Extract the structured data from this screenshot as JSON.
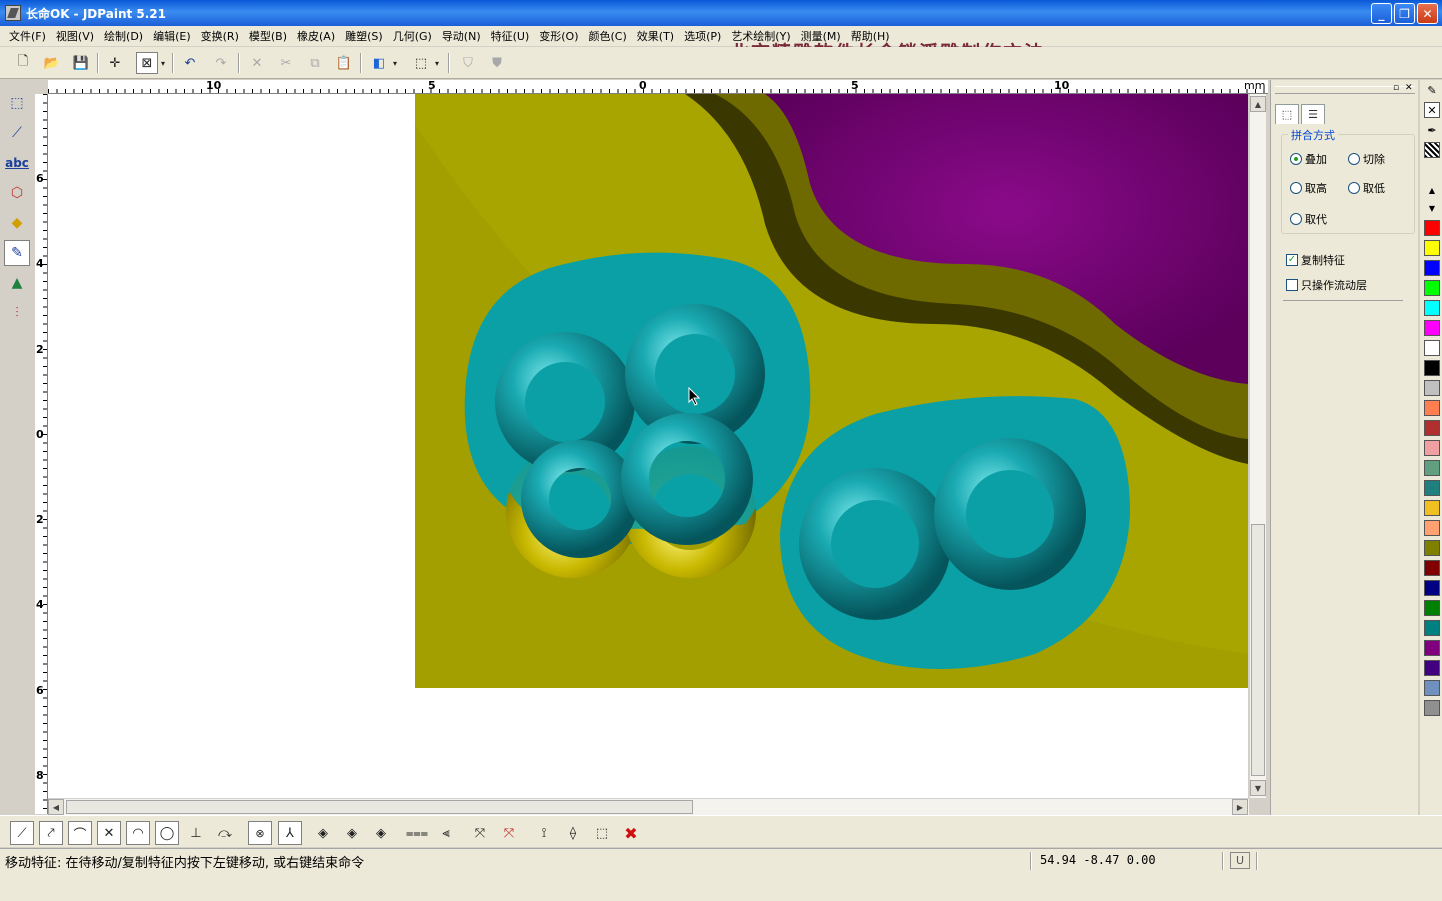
{
  "window": {
    "title": "长命OK - JDPaint 5.21"
  },
  "menu": [
    "文件(F)",
    "视图(V)",
    "绘制(D)",
    "编辑(E)",
    "变换(R)",
    "模型(B)",
    "橡皮(A)",
    "雕塑(S)",
    "几何(G)",
    "导动(N)",
    "特征(U)",
    "变形(O)",
    "颜色(C)",
    "效果(T)",
    "选项(P)",
    "艺术绘制(Y)",
    "测量(M)",
    "帮助(H)"
  ],
  "overlay_title": "北京精雕软件长命锁浮雕制作方法",
  "ruler": {
    "unit": "mm",
    "h_labels": [
      "10",
      "5",
      "0",
      "5",
      "10"
    ],
    "v_labels": [
      "6",
      "4",
      "2",
      "0",
      "2",
      "4",
      "6",
      "8"
    ]
  },
  "panel": {
    "group_title": "拼合方式",
    "radios": [
      {
        "label": "叠加",
        "checked": true
      },
      {
        "label": "切除",
        "checked": false
      },
      {
        "label": "取高",
        "checked": false
      },
      {
        "label": "取低",
        "checked": false
      },
      {
        "label": "取代",
        "checked": false
      }
    ],
    "checkboxes": [
      {
        "label": "复制特征",
        "checked": true
      },
      {
        "label": "只操作流动层",
        "checked": false
      }
    ]
  },
  "palette_colors": [
    "#ff0000",
    "#ffff00",
    "#0000ff",
    "#00ff00",
    "#00ffff",
    "#ff00ff",
    "#ffffff",
    "#000000",
    "#c0c0c0",
    "#ff7f50",
    "#b03030",
    "#f0a0a0",
    "#60a080",
    "#208080",
    "#f0c020",
    "#ffa070",
    "#808000",
    "#800000",
    "#000080",
    "#008000",
    "#008080",
    "#800080",
    "#400080",
    "#7090c0",
    "#909090"
  ],
  "status": {
    "message": "移动特征: 在待移动/复制特征内按下左键移动, 或右键结束命令",
    "coords": "54.94 -8.47 0.00",
    "mode_indicator": "U"
  },
  "colors": {
    "base": "#a8a400",
    "relief_purple": "#800080",
    "feature_cyan": "#0aa0a6"
  }
}
